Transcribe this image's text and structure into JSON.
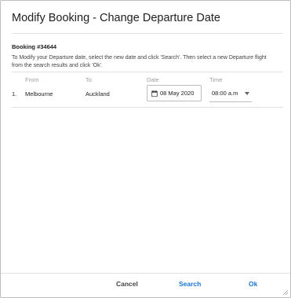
{
  "dialog": {
    "title": "Modify Booking - Change Departure Date",
    "booking_label": "Booking #34644",
    "instructions": "To Modify your Departure date, select the new date and click 'Search'. Then select a new Departure flight from the search results and click 'Ok'."
  },
  "table": {
    "headers": {
      "from": "From",
      "to": "To",
      "date": "Date",
      "time": "Time"
    },
    "rows": [
      {
        "index": "1.",
        "from": "Melbourne",
        "to": "Auckland",
        "date": "08 May 2020",
        "time": "08:00 a.m"
      }
    ]
  },
  "footer": {
    "cancel_label": "Cancel",
    "search_label": "Search",
    "ok_label": "Ok"
  },
  "colors": {
    "accent": "#1976d2",
    "border": "#bdbdbd"
  }
}
